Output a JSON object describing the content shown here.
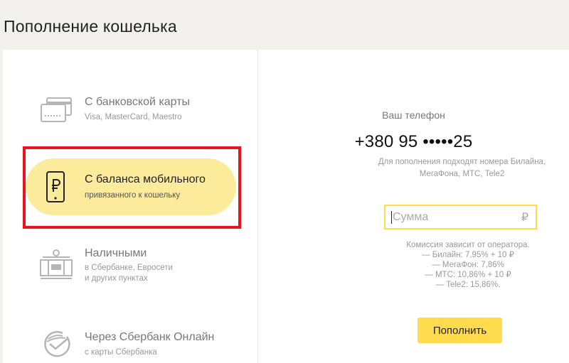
{
  "page": {
    "title": "Пополнение кошелька"
  },
  "methods": [
    {
      "title": "С банковской карты",
      "subtitle": "Visa, MasterCard, Maestro"
    },
    {
      "title": "С баланса мобильного",
      "subtitle": "привязанного к кошельку"
    },
    {
      "title": "Наличными",
      "subtitle_line1": "в Сбербанке, Евросети",
      "subtitle_line2": "и других пунктах"
    },
    {
      "title": "Через Сбербанк Онлайн",
      "subtitle": "с карты Сбербанка"
    }
  ],
  "phone": {
    "label": "Ваш телефон",
    "number": "+380 95 •••••25",
    "hint_line1": "Для пополнения подходят номера Билайна,",
    "hint_line2": "МегаФона, МТС, Tele2"
  },
  "amount": {
    "placeholder": "Сумма",
    "currency": "₽",
    "value": ""
  },
  "commission": {
    "title": "Комиссия зависит от оператора.",
    "lines": [
      "— Билайн: 7,95% + 10 ₽",
      "— МегаФон: 7,86%",
      "— МТС: 10,86% + 10 ₽",
      "— Tele2: 15,86%."
    ]
  },
  "submit": {
    "label": "Пополнить"
  },
  "colors": {
    "accent": "#ffdb4d",
    "selected_bg": "#fdeb9c",
    "highlight": "#e8141e"
  }
}
